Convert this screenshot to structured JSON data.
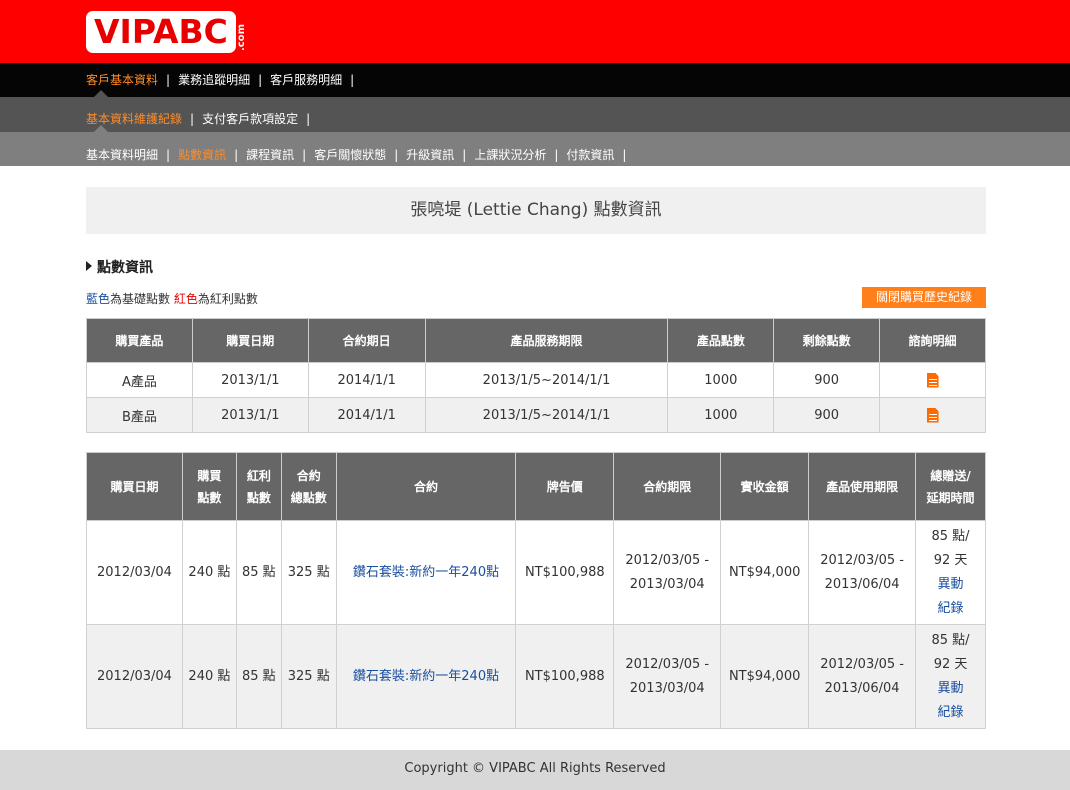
{
  "brand": {
    "logo_text": "VIPABC",
    "logo_suffix": ".com",
    "accent_red": "#ff0000",
    "accent_orange": "#ff8c26"
  },
  "nav1": [
    "客戶基本資料",
    "業務追蹤明細",
    "客戶服務明細"
  ],
  "nav2": [
    "基本資料維護紀錄",
    "支付客戶款項設定"
  ],
  "nav3": [
    "基本資料明細",
    "點數資訊",
    "課程資訊",
    "客戶關懷狀態",
    "升級資訊",
    "上課狀況分析",
    "付款資訊"
  ],
  "page_title": "張喨堤 (Lettie Chang) 點數資訊",
  "section_title": "點數資訊",
  "legend": {
    "blue_word": "藍色",
    "blue_text": "為基礎點數",
    "red_word": "紅色",
    "red_text": "為紅利點數"
  },
  "toggle_button": "關閉購買歷史紀錄",
  "table1": {
    "headers": [
      "購買產品",
      "購買日期",
      "合約期日",
      "產品服務期限",
      "產品點數",
      "剩餘點數",
      "諮詢明細"
    ],
    "rows": [
      [
        "A產品",
        "2013/1/1",
        "2014/1/1",
        "2013/1/5~2014/1/1",
        "1000",
        "900"
      ],
      [
        "B產品",
        "2013/1/1",
        "2014/1/1",
        "2013/1/5~2014/1/1",
        "1000",
        "900"
      ]
    ]
  },
  "table2": {
    "headers": [
      "購買日期",
      "購買\n點數",
      "紅利\n點數",
      "合約\n總點數",
      "合約",
      "牌告價",
      "合約期限",
      "實收金額",
      "產品使用期限",
      "總贈送/\n延期時間"
    ],
    "rows": [
      {
        "date": "2012/03/04",
        "buy_points": "240 點",
        "bonus_points": "85 點",
        "total_points": "325 點",
        "contract": "鑽石套裝:新約一年240點",
        "list_price": "NT$100,988",
        "period_start": "2012/03/05 -",
        "period_end": "2013/03/04",
        "paid": "NT$94,000",
        "use_start": "2012/03/05 -",
        "use_end": "2013/06/04",
        "gift_points": "85 點/",
        "gift_days": "92 天",
        "change_link_1": "異動",
        "change_link_2": "紀錄"
      },
      {
        "date": "2012/03/04",
        "buy_points": "240 點",
        "bonus_points": "85 點",
        "total_points": "325 點",
        "contract": "鑽石套裝:新約一年240點",
        "list_price": "NT$100,988",
        "period_start": "2012/03/05 -",
        "period_end": "2013/03/04",
        "paid": "NT$94,000",
        "use_start": "2012/03/05 -",
        "use_end": "2013/06/04",
        "gift_points": "85 點/",
        "gift_days": "92 天",
        "change_link_1": "異動",
        "change_link_2": "紀錄"
      }
    ]
  },
  "footer": "Copyright © VIPABC All Rights Reserved"
}
